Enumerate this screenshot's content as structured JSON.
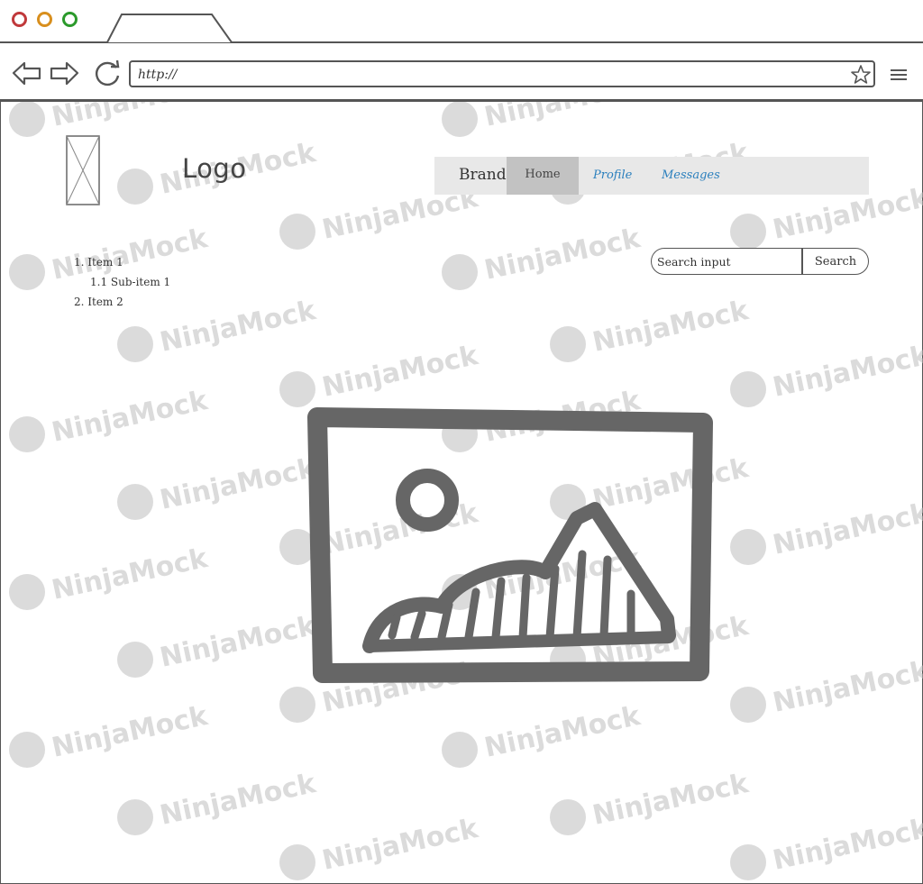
{
  "browser": {
    "url": "http://",
    "window_controls": [
      "close-dot-red",
      "minimize-dot-yellow",
      "maximize-dot-green"
    ]
  },
  "page": {
    "logo_text": "Logo",
    "nav": {
      "brand": "Brand",
      "items": [
        {
          "label": "Home",
          "active": true
        },
        {
          "label": "Profile",
          "active": false
        },
        {
          "label": "Messages",
          "active": false
        }
      ]
    },
    "list": {
      "item_1": "1. Item 1",
      "sub_item_1": "1.1 Sub-item 1",
      "item_2": "2. Item 2"
    },
    "search": {
      "placeholder": "Search input",
      "button_label": "Search"
    }
  },
  "watermark": "NinjaMock",
  "colors": {
    "close": "#c0393b",
    "minimize": "#d88f1e",
    "maximize": "#2b9a2b",
    "link": "#2a7fbd",
    "nav_background": "#e8e8e8",
    "nav_active": "#c2c2c2",
    "sketch_stroke": "#555555"
  }
}
